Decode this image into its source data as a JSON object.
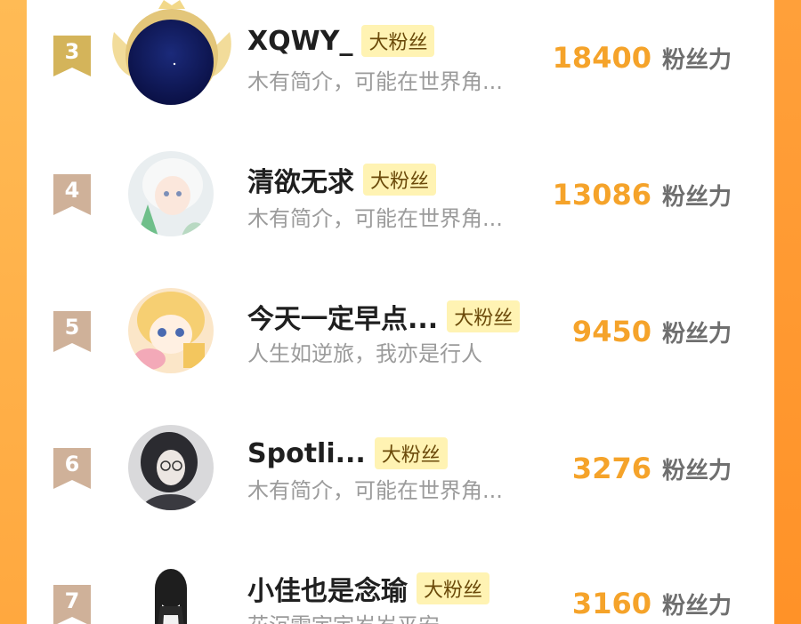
{
  "ranking": {
    "unit_label": "粉丝力",
    "badge_label": "大粉丝",
    "rows": [
      {
        "rank": "3",
        "name": "XQWY_",
        "bio": "木有简介，可能在世界角...",
        "score": "18400",
        "avatar": "night-sky-avatar",
        "frame": "gold-crown"
      },
      {
        "rank": "4",
        "name": "清欲无求",
        "bio": "木有简介，可能在世界角...",
        "score": "13086",
        "avatar": "anime-girl-white-hair-avatar"
      },
      {
        "rank": "5",
        "name": "今天一定早点...",
        "bio": "人生如逆旅，我亦是行人",
        "score": "9450",
        "avatar": "anime-girl-blonde-avatar"
      },
      {
        "rank": "6",
        "name": "Spotli...",
        "bio": "木有简介，可能在世界角...",
        "score": "3276",
        "avatar": "girl-dark-hair-glasses-avatar"
      },
      {
        "rank": "7",
        "name": "小佳也是念瑜",
        "bio": "花沉雪宇宇岁岁平安",
        "score": "3160",
        "avatar": "dark-figure-avatar"
      }
    ]
  },
  "colors": {
    "score": "#f5a32a",
    "rank_gold": "#d4b45a",
    "rank_bronze": "#cfb199",
    "badge_bg": "#fff3b3",
    "side_orange": "#ffa83f"
  }
}
